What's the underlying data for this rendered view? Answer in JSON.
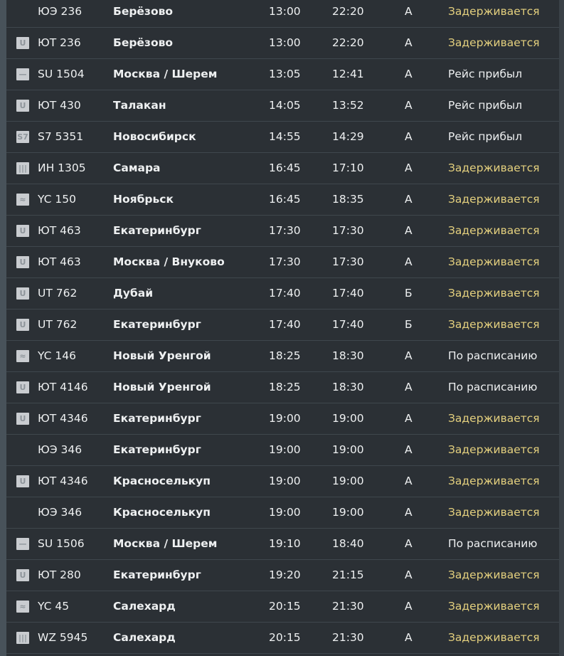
{
  "colors": {
    "background": "#2b3035",
    "text": "#eef0f1",
    "delayed": "#e4d07e"
  },
  "flights": [
    {
      "logo": "none",
      "flight": "ЮЭ 236",
      "city": "Берёзово",
      "scheduled": "13:00",
      "actual": "22:20",
      "terminal": "А",
      "status": "Задерживается",
      "delayed": true
    },
    {
      "logo": "utair",
      "flight": "ЮТ 236",
      "city": "Берёзово",
      "scheduled": "13:00",
      "actual": "22:20",
      "terminal": "А",
      "status": "Задерживается",
      "delayed": true
    },
    {
      "logo": "aeroflot",
      "flight": "SU 1504",
      "city": "Москва / Шерем",
      "scheduled": "13:05",
      "actual": "12:41",
      "terminal": "А",
      "status": "Рейс прибыл",
      "delayed": false
    },
    {
      "logo": "utair",
      "flight": "ЮТ 430",
      "city": "Талакан",
      "scheduled": "14:05",
      "actual": "13:52",
      "terminal": "А",
      "status": "Рейс прибыл",
      "delayed": false
    },
    {
      "logo": "s7",
      "flight": "S7 5351",
      "city": "Новосибирск",
      "scheduled": "14:55",
      "actual": "14:29",
      "terminal": "А",
      "status": "Рейс прибыл",
      "delayed": false
    },
    {
      "logo": "izhavia",
      "flight": "ИН 1305",
      "city": "Самара",
      "scheduled": "16:45",
      "actual": "17:10",
      "terminal": "А",
      "status": "Задерживается",
      "delayed": true
    },
    {
      "logo": "yamal",
      "flight": "YC 150",
      "city": "Ноябрьск",
      "scheduled": "16:45",
      "actual": "18:35",
      "terminal": "А",
      "status": "Задерживается",
      "delayed": true
    },
    {
      "logo": "utair",
      "flight": "ЮТ 463",
      "city": "Екатеринбург",
      "scheduled": "17:30",
      "actual": "17:30",
      "terminal": "А",
      "status": "Задерживается",
      "delayed": true
    },
    {
      "logo": "utair",
      "flight": "ЮТ 463",
      "city": "Москва / Внуково",
      "scheduled": "17:30",
      "actual": "17:30",
      "terminal": "А",
      "status": "Задерживается",
      "delayed": true
    },
    {
      "logo": "utair",
      "flight": "UT 762",
      "city": "Дубай",
      "scheduled": "17:40",
      "actual": "17:40",
      "terminal": "Б",
      "status": "Задерживается",
      "delayed": true
    },
    {
      "logo": "utair",
      "flight": "UT 762",
      "city": "Екатеринбург",
      "scheduled": "17:40",
      "actual": "17:40",
      "terminal": "Б",
      "status": "Задерживается",
      "delayed": true
    },
    {
      "logo": "yamal",
      "flight": "YC 146",
      "city": "Новый Уренгой",
      "scheduled": "18:25",
      "actual": "18:30",
      "terminal": "А",
      "status": "По расписанию",
      "delayed": false
    },
    {
      "logo": "utair",
      "flight": "ЮТ 4146",
      "city": "Новый Уренгой",
      "scheduled": "18:25",
      "actual": "18:30",
      "terminal": "А",
      "status": "По расписанию",
      "delayed": false
    },
    {
      "logo": "utair",
      "flight": "ЮТ 4346",
      "city": "Екатеринбург",
      "scheduled": "19:00",
      "actual": "19:00",
      "terminal": "А",
      "status": "Задерживается",
      "delayed": true
    },
    {
      "logo": "none",
      "flight": "ЮЭ 346",
      "city": "Екатеринбург",
      "scheduled": "19:00",
      "actual": "19:00",
      "terminal": "А",
      "status": "Задерживается",
      "delayed": true
    },
    {
      "logo": "utair",
      "flight": "ЮТ 4346",
      "city": "Красноселькуп",
      "scheduled": "19:00",
      "actual": "19:00",
      "terminal": "А",
      "status": "Задерживается",
      "delayed": true
    },
    {
      "logo": "none",
      "flight": "ЮЭ 346",
      "city": "Красноселькуп",
      "scheduled": "19:00",
      "actual": "19:00",
      "terminal": "А",
      "status": "Задерживается",
      "delayed": true
    },
    {
      "logo": "aeroflot",
      "flight": "SU 1506",
      "city": "Москва / Шерем",
      "scheduled": "19:10",
      "actual": "18:40",
      "terminal": "А",
      "status": "По расписанию",
      "delayed": false
    },
    {
      "logo": "utair",
      "flight": "ЮТ 280",
      "city": "Екатеринбург",
      "scheduled": "19:20",
      "actual": "21:15",
      "terminal": "А",
      "status": "Задерживается",
      "delayed": true
    },
    {
      "logo": "yamal",
      "flight": "YC 45",
      "city": "Салехард",
      "scheduled": "20:15",
      "actual": "21:30",
      "terminal": "А",
      "status": "Задерживается",
      "delayed": true
    },
    {
      "logo": "izhavia",
      "flight": "WZ 5945",
      "city": "Салехард",
      "scheduled": "20:15",
      "actual": "21:30",
      "terminal": "А",
      "status": "Задерживается",
      "delayed": true
    }
  ]
}
